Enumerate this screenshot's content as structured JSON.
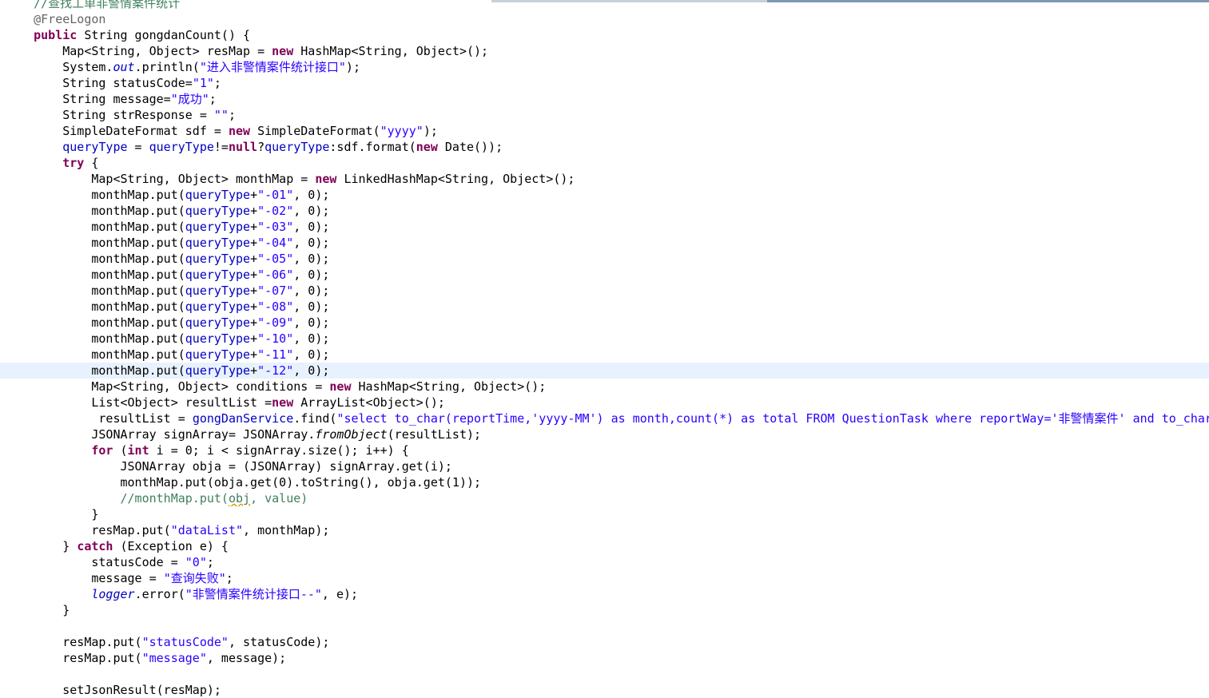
{
  "code": {
    "comment_top": "//查找工单非警情案件统计",
    "annotation": "@FreeLogon",
    "method_sig": "String gongdanCount() {",
    "kw_public": "public",
    "kw_new": "new",
    "kw_try": "try",
    "kw_null": "null",
    "kw_for": "for",
    "kw_int": "int",
    "kw_catch": "catch",
    "l3_a": "    Map<String, Object> resMap = ",
    "l3_b": " HashMap<String, Object>();",
    "l4_a": "    System.",
    "l4_out": "out",
    "l4_b": ".println(",
    "l4_str": "\"进入非警情案件统计接口\"",
    "l4_c": ");",
    "l5_a": "    String statusCode=",
    "l5_str": "\"1\"",
    "semi": ";",
    "l6_a": "    String message=",
    "l6_str": "\"成功\"",
    "l7_a": "    String strResponse = ",
    "l7_str": "\"\"",
    "l8_a": "    SimpleDateFormat sdf = ",
    "l8_b": " SimpleDateFormat(",
    "l8_str": "\"yyyy\"",
    "l8_c": ");",
    "indent4": "    ",
    "indent8": "        ",
    "indent9": "         ",
    "indent12": "            ",
    "queryType": "queryType",
    "l9_b": " = ",
    "l9_c": "!=",
    "l9_d": "?",
    "l9_e": ":sdf.format(",
    "l9_f": " Date());",
    "brace_open": " {",
    "l11_a": "        Map<String, Object> monthMap = ",
    "l11_b": " LinkedHashMap<String, Object>();",
    "put_prefix": "        monthMap.put(",
    "put_plus": "+",
    "put_suffix": ", 0);",
    "months": [
      "\"-01\"",
      "\"-02\"",
      "\"-03\"",
      "\"-04\"",
      "\"-05\"",
      "\"-06\"",
      "\"-07\"",
      "\"-08\"",
      "\"-09\"",
      "\"-10\"",
      "\"-11\"",
      "\"-12\""
    ],
    "l24_a": "        Map<String, Object> conditions = ",
    "l24_b": " HashMap<String, Object>();",
    "l25_a": "        List<Object> resultList =",
    "l25_b": " ArrayList<Object>();",
    "l26_a": "resultList = ",
    "l26_svc": "gongDanService",
    "l26_b": ".find(",
    "l26_str": "\"select to_char(reportTime,'yyyy-MM') as month,count(*) as total FROM QuestionTask where reportWay='非警情案件' and to_char(reportTime,'yyyy')='\"",
    "l27_a": "        JSONArray signArray= JSONArray.",
    "l27_it": "fromObject",
    "l27_b": "(resultList);",
    "l28_a": " (",
    "l28_b": " i = 0; i < signArray.size(); i++) {",
    "l29": "            JSONArray obja = (JSONArray) signArray.get(i);",
    "l30": "            monthMap.put(obja.get(0).toString(), obja.get(1));",
    "l31_a": "            //monthMap.put(",
    "l31_obj": "obj",
    "l31_b": ", value)",
    "l32": "        }",
    "l33_a": "        resMap.put(",
    "l33_str": "\"dataList\"",
    "l33_b": ", monthMap);",
    "l34_a": "    } ",
    "l34_b": " (Exception e) {",
    "l35_a": "        statusCode = ",
    "l35_str": "\"0\"",
    "l36_a": "        message = ",
    "l36_str": "\"查询失败\"",
    "l37_logger": "logger",
    "l37_b": ".error(",
    "l37_str": "\"非警情案件统计接口--\"",
    "l37_c": ", e);",
    "l38": "    }",
    "l40_a": "    resMap.put(",
    "l40_str": "\"statusCode\"",
    "l40_b": ", statusCode);",
    "l41_str": "\"message\"",
    "l41_b": ", message);",
    "l43": "    setJsonResult(resMap);"
  },
  "colors": {
    "keyword": "#7f0055",
    "string": "#2a00ff",
    "field": "#0000c0",
    "comment": "#3f7f5f",
    "annotation": "#646464",
    "current_line": "#e8f2fe"
  }
}
